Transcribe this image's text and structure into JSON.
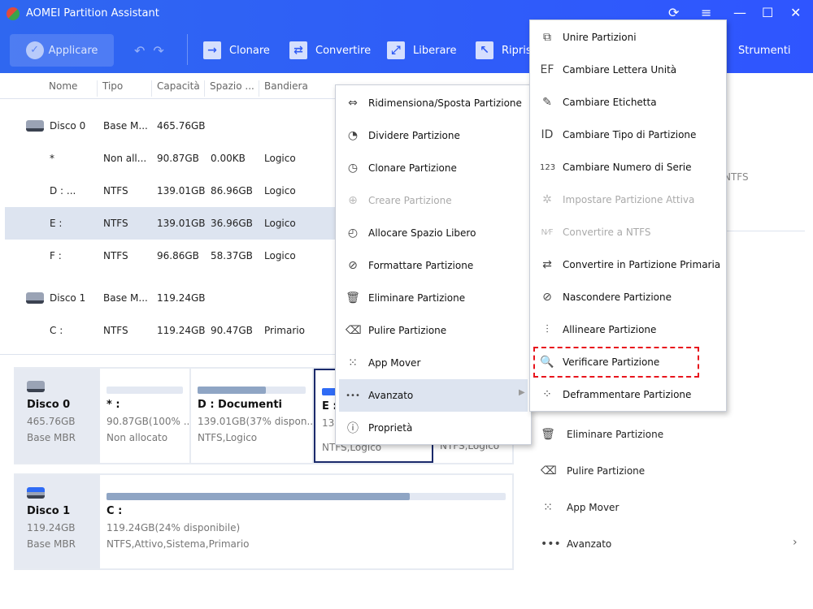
{
  "window": {
    "title": "AOMEI Partition Assistant"
  },
  "toolbar": {
    "apply": "Applicare",
    "clone": "Clonare",
    "convert": "Convertire",
    "free": "Liberare",
    "restore": "Ripristi",
    "tools": "Strumenti"
  },
  "table": {
    "headers": [
      "Nome",
      "Tipo",
      "Capacità",
      "Spazio ...",
      "Bandiera"
    ],
    "rows": [
      {
        "name": "Disco 0",
        "type": "Base M...",
        "capacity": "465.76GB",
        "free": "",
        "flag": ""
      },
      {
        "name": "*",
        "type": "Non all...",
        "capacity": "90.87GB",
        "free": "0.00KB",
        "flag": "Logico"
      },
      {
        "name": "D : ...",
        "type": "NTFS",
        "capacity": "139.01GB",
        "free": "86.96GB",
        "flag": "Logico"
      },
      {
        "name": "E :",
        "type": "NTFS",
        "capacity": "139.01GB",
        "free": "36.96GB",
        "flag": "Logico"
      },
      {
        "name": "F :",
        "type": "NTFS",
        "capacity": "96.86GB",
        "free": "58.37GB",
        "flag": "Logico"
      },
      {
        "name": "Disco 1",
        "type": "Base M...",
        "capacity": "119.24GB",
        "free": "",
        "flag": ""
      },
      {
        "name": "C :",
        "type": "NTFS",
        "capacity": "119.24GB",
        "free": "90.47GB",
        "flag": "Primario"
      }
    ]
  },
  "disks": [
    {
      "name": "Disco 0",
      "size": "465.76GB",
      "type": "Base MBR",
      "partitions": [
        {
          "label": "* :",
          "info": "90.87GB(100% ...",
          "fs": "Non allocato",
          "used_pct": 0
        },
        {
          "label": "D : Documenti",
          "info": "139.01GB(37% dispon...",
          "fs": "NTFS,Logico",
          "used_pct": 63
        },
        {
          "label": "E :",
          "info": "139",
          "fs": "NTFS,Logico",
          "used_pct": 73
        },
        {
          "label": "",
          "info": "",
          "fs": "NTFS,Logico",
          "used_pct": 40
        }
      ]
    },
    {
      "name": "Disco 1",
      "size": "119.24GB",
      "type": "Base MBR",
      "partitions": [
        {
          "label": "C :",
          "info": "119.24GB(24% disponibile)",
          "fs": "NTFS,Attivo,Sistema,Primario",
          "used_pct": 76
        }
      ]
    }
  ],
  "context_menu": [
    {
      "label": "Ridimensiona/Sposta Partizione",
      "icon": "resize-icon"
    },
    {
      "label": "Dividere Partizione",
      "icon": "split-icon"
    },
    {
      "label": "Clonare Partizione",
      "icon": "clone-icon"
    },
    {
      "label": "Creare Partizione",
      "icon": "create-icon",
      "disabled": true
    },
    {
      "label": "Allocare Spazio Libero",
      "icon": "allocate-icon"
    },
    {
      "label": "Formattare Partizione",
      "icon": "format-icon"
    },
    {
      "label": "Eliminare Partizione",
      "icon": "trash-icon"
    },
    {
      "label": "Pulire Partizione",
      "icon": "eraser-icon"
    },
    {
      "label": "App Mover",
      "icon": "app-mover-icon"
    },
    {
      "label": "Avanzato",
      "icon": "more-icon",
      "highlighted": true
    },
    {
      "label": "Proprietà",
      "icon": "info-icon"
    }
  ],
  "submenu": [
    {
      "label": "Unire Partizioni",
      "icon": "merge-icon"
    },
    {
      "label": "Cambiare Lettera Unità",
      "icon": "drive-letter-icon"
    },
    {
      "label": "Cambiare Etichetta",
      "icon": "pencil-icon"
    },
    {
      "label": "Cambiare Tipo di Partizione",
      "icon": "id-icon"
    },
    {
      "label": "Cambiare Numero di Serie",
      "icon": "serial-icon"
    },
    {
      "label": "Impostare Partizione Attiva",
      "icon": "active-icon",
      "disabled": true
    },
    {
      "label": "Convertire a NTFS",
      "icon": "ntfs-icon",
      "disabled": true
    },
    {
      "label": "Convertire in Partizione Primaria",
      "icon": "convert-icon"
    },
    {
      "label": "Nascondere Partizione",
      "icon": "hide-icon"
    },
    {
      "label": "Allineare Partizione",
      "icon": "align-icon"
    },
    {
      "label": "Verificare Partizione",
      "icon": "search-icon",
      "highlighted_box": true
    },
    {
      "label": "Deframmentare Partizione",
      "icon": "defrag-icon"
    }
  ],
  "right_panel": {
    "fs": "NTFS",
    "items": [
      "Eliminare Partizione",
      "Pulire Partizione",
      "App Mover",
      "Avanzato"
    ]
  },
  "colors": {
    "accent": "#2f5bf5",
    "highlight_box": "#e8141c",
    "selected_row": "#dde4f0"
  }
}
